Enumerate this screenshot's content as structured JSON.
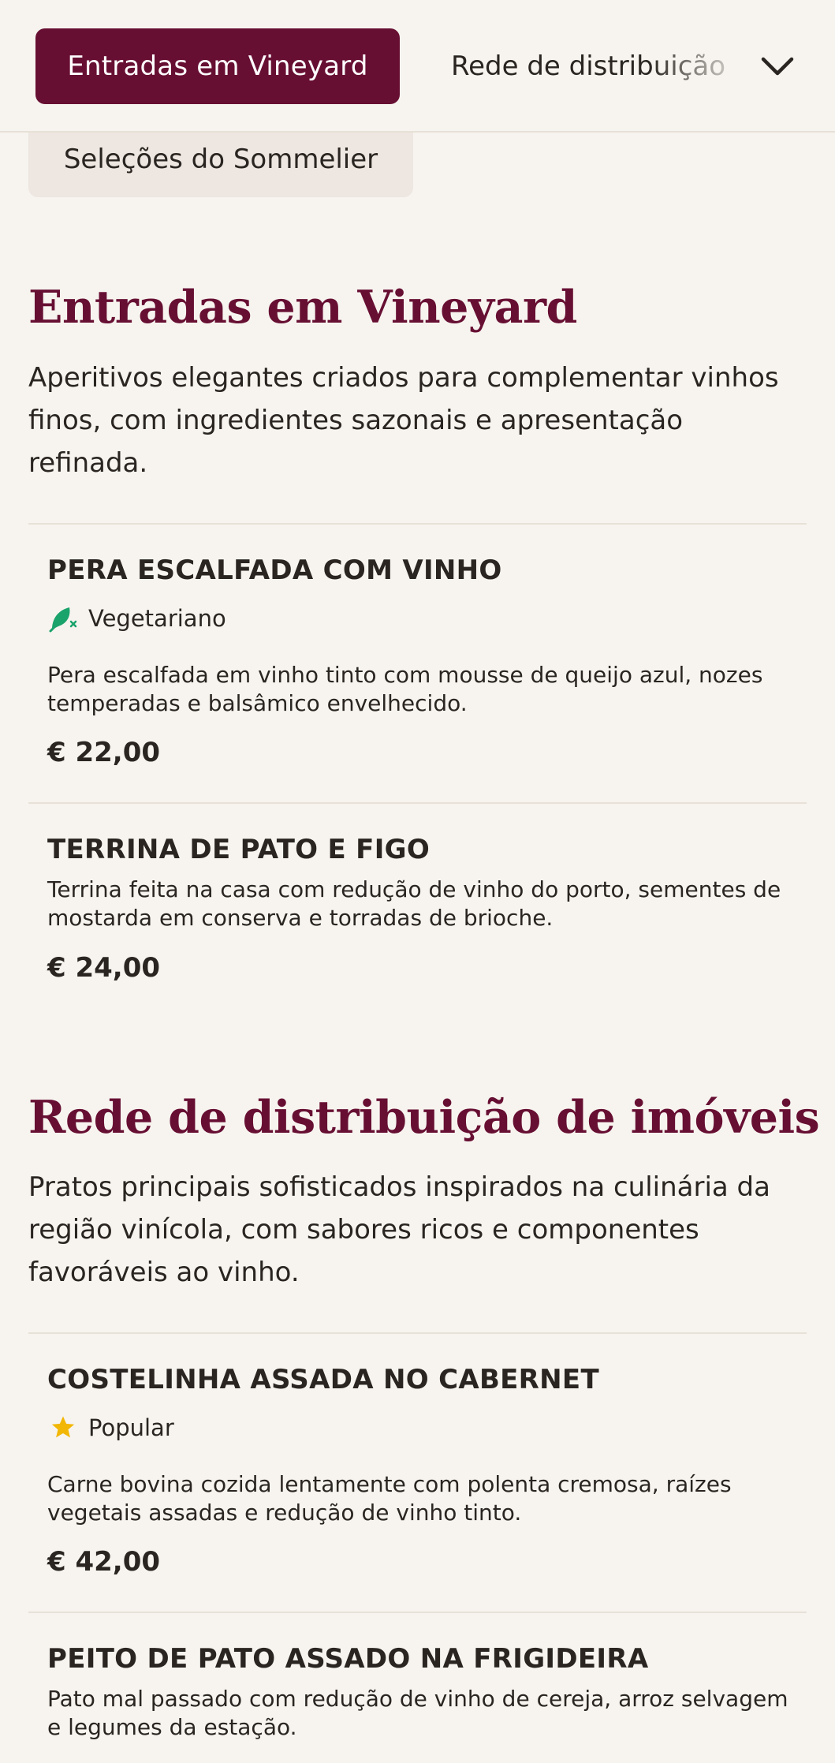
{
  "nav": {
    "active_tab": "Entradas em Vineyard",
    "next_tab": "Rede de distribuição",
    "secondary_chip": "Seleções do Sommelier",
    "chevron_icon": "chevron-down-icon"
  },
  "colors": {
    "accent": "#670f33",
    "background": "#f7f4ef",
    "chip": "#ede6e1",
    "vegetarian": "#1aa36b",
    "star": "#f2b705"
  },
  "sections": [
    {
      "title": "Entradas em Vineyard",
      "description": "Aperitivos elegantes criados para complementar vinhos finos, com ingredientes sazonais e apresentação refinada.",
      "items": [
        {
          "name": "PERA ESCALFADA COM VINHO",
          "badge": {
            "icon": "vegetarian-leaf-icon",
            "label": "Vegetariano"
          },
          "description": "Pera escalfada em vinho tinto com mousse de queijo azul, nozes temperadas e balsâmico envelhecido.",
          "price": "€ 22,00"
        },
        {
          "name": "TERRINA DE PATO E FIGO",
          "description": "Terrina feita na casa com redução de vinho do porto, sementes de mostarda em conserva e torradas de brioche.",
          "price": "€ 24,00"
        }
      ]
    },
    {
      "title": "Rede de distribuição de imóveis",
      "description": "Pratos principais sofisticados inspirados na culinária da região vinícola, com sabores ricos e componentes favoráveis ao vinho.",
      "items": [
        {
          "name": "COSTELINHA ASSADA NO CABERNET",
          "badge": {
            "icon": "star-icon",
            "label": "Popular"
          },
          "description": "Carne bovina cozida lentamente com polenta cremosa, raízes vegetais assadas e redução de vinho tinto.",
          "price": "€ 42,00"
        },
        {
          "name": "PEITO DE PATO ASSADO NA FRIGIDEIRA",
          "description": "Pato mal passado com redução de vinho de cereja, arroz selvagem e legumes da estação."
        }
      ]
    }
  ]
}
